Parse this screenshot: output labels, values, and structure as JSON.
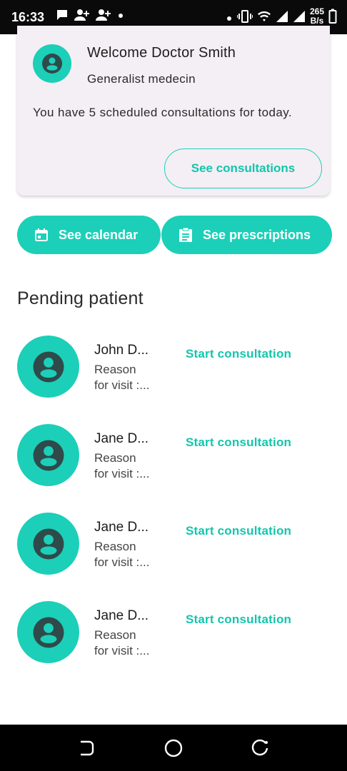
{
  "status_bar": {
    "time": "16:33",
    "speed_value": "265",
    "speed_unit": "B/s",
    "icons": [
      "chat-bubble-icon",
      "person-add-icon",
      "person-add-icon",
      "dot-icon",
      "dot-icon",
      "vibrate-icon",
      "wifi-icon",
      "signal-icon",
      "signal-icon",
      "battery-icon"
    ]
  },
  "welcome": {
    "title": "Welcome Doctor Smith",
    "subtitle": "Generalist medecin",
    "message": "You have 5 scheduled consultations for today.",
    "button_label": "See consultations"
  },
  "actions": {
    "calendar_label": "See calendar",
    "prescriptions_label": "See prescriptions"
  },
  "pending": {
    "title": "Pending patient",
    "patients": [
      {
        "name": "John D...",
        "reason_line1": "Reason",
        "reason_line2": "for visit :...",
        "action": "Start consultation"
      },
      {
        "name": "Jane D...",
        "reason_line1": "Reason",
        "reason_line2": "for visit :...",
        "action": "Start consultation"
      },
      {
        "name": "Jane D...",
        "reason_line1": "Reason",
        "reason_line2": "for visit :...",
        "action": "Start consultation"
      },
      {
        "name": "Jane D...",
        "reason_line1": "Reason",
        "reason_line2": "for visit :...",
        "action": "Start consultation"
      }
    ]
  },
  "colors": {
    "accent": "#1ccfb8",
    "accent_text": "#12c6ad",
    "card_background": "#f4eff4",
    "avatar_glyph": "#2f4a4a"
  }
}
